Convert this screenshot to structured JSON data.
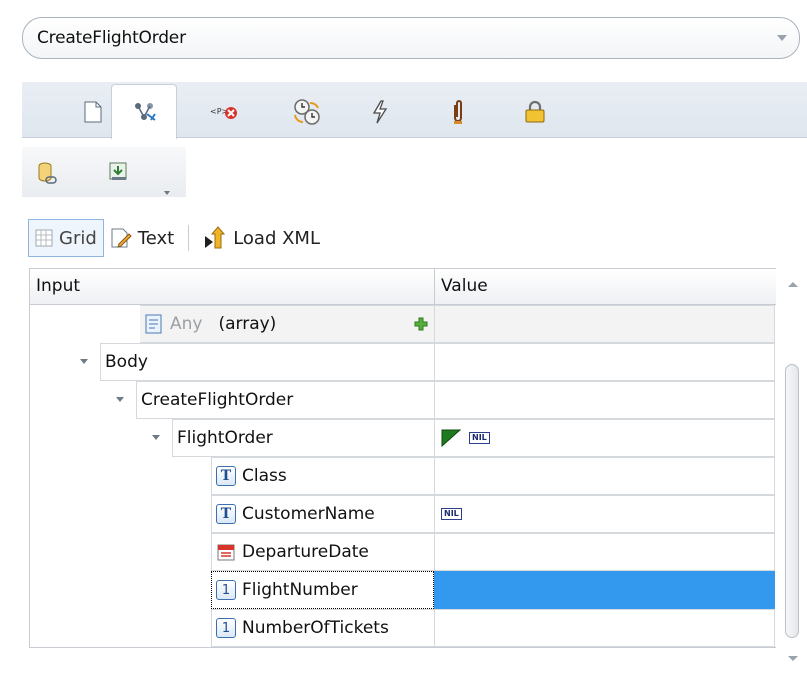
{
  "operation": {
    "name": "CreateFlightOrder"
  },
  "tabs": [
    {
      "icon": "document-icon"
    },
    {
      "icon": "input-mapping-icon",
      "active": true
    },
    {
      "icon": "xpath-checkpoint-icon"
    },
    {
      "icon": "sync-clocks-icon"
    },
    {
      "icon": "events-lightning-icon"
    },
    {
      "icon": "attachment-icon"
    },
    {
      "icon": "security-lock-icon"
    }
  ],
  "toolbar": [
    {
      "icon": "database-link-icon"
    },
    {
      "icon": "import-data-icon"
    }
  ],
  "view_buttons": {
    "grid": "Grid",
    "text": "Text",
    "load_xml": "Load XML"
  },
  "grid": {
    "col_input": "Input",
    "col_value": "Value",
    "rows": [
      {
        "name": "Any",
        "suffix": "(array)",
        "icon": "any-element-icon"
      },
      {
        "name": "Body"
      },
      {
        "name": "CreateFlightOrder"
      },
      {
        "name": "FlightOrder"
      },
      {
        "name": "Class",
        "icon": "text-type-icon"
      },
      {
        "name": "CustomerName",
        "icon": "text-type-icon",
        "value_badge": "NIL"
      },
      {
        "name": "DepartureDate",
        "icon": "date-type-icon"
      },
      {
        "name": "FlightNumber",
        "icon": "number-type-icon",
        "selected": true
      },
      {
        "name": "NumberOfTickets",
        "icon": "number-type-icon"
      }
    ],
    "flightorder_badge": "NIL",
    "glyph_T": "T",
    "glyph_1": "1"
  },
  "colors": {
    "selection": "#3399ee",
    "tab_bg": "#e3e9f0",
    "border": "#c7ccd2"
  }
}
